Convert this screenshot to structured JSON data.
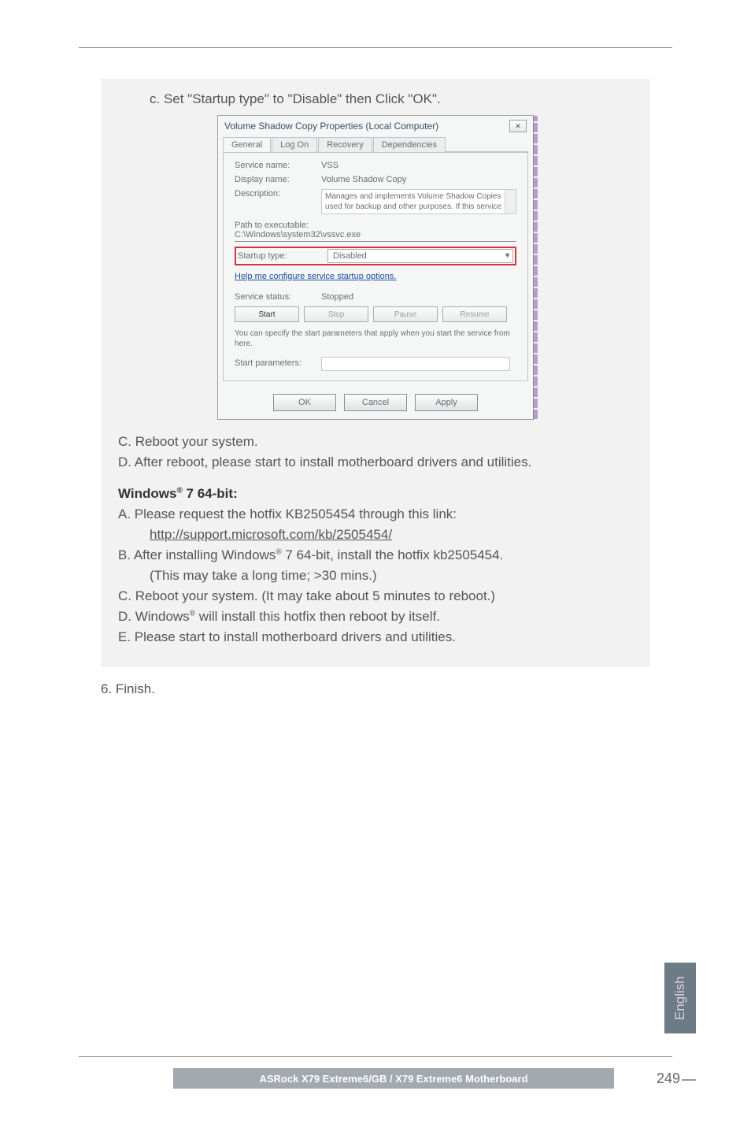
{
  "step_c": "c. Set \"Startup type\" to \"Disable\" then Click \"OK\".",
  "dialog": {
    "title": "Volume Shadow Copy Properties (Local Computer)",
    "close": "✕",
    "tabs": [
      "General",
      "Log On",
      "Recovery",
      "Dependencies"
    ],
    "service_name_label": "Service name:",
    "service_name": "VSS",
    "display_name_label": "Display name:",
    "display_name": "Volume Shadow Copy",
    "description_label": "Description:",
    "description": "Manages and implements Volume Shadow Copies used for backup and other purposes. If this service",
    "path_label": "Path to executable:",
    "path_value": "C:\\Windows\\system32\\vssvc.exe",
    "startup_label": "Startup type:",
    "startup_value": "Disabled",
    "help_link": "Help me configure service startup options.",
    "status_label": "Service status:",
    "status_value": "Stopped",
    "btn_start": "Start",
    "btn_stop": "Stop",
    "btn_pause": "Pause",
    "btn_resume": "Resume",
    "hint": "You can specify the start parameters that apply when you start the service from here.",
    "params_label": "Start parameters:",
    "ok": "OK",
    "cancel": "Cancel",
    "apply": "Apply"
  },
  "line_C": "C. Reboot your system.",
  "line_D": "D. After reboot, please start to install motherboard drivers and utilities.",
  "win_heading_a": "Windows",
  "win_heading_b": " 7 64-bit:",
  "win64": {
    "A": "A. Please request the hotfix KB2505454 through this link:",
    "A_link": "http://support.microsoft.com/kb/2505454/",
    "B1": "B. After installing Windows",
    "B2": " 7 64-bit, install the hotfix kb2505454.",
    "B_note": "(This may take a long time; >30 mins.)",
    "C": "C. Reboot your system. (It may take about 5 minutes to reboot.)",
    "D1": "D. Windows",
    "D2": " will install this hotfix then reboot by itself.",
    "E": "E. Please start to install motherboard drivers and utilities."
  },
  "finish": "6. Finish.",
  "lang": "English",
  "footer": "ASRock  X79 Extreme6/GB / X79 Extreme6  Motherboard",
  "pagenum": "249",
  "reg": "®"
}
